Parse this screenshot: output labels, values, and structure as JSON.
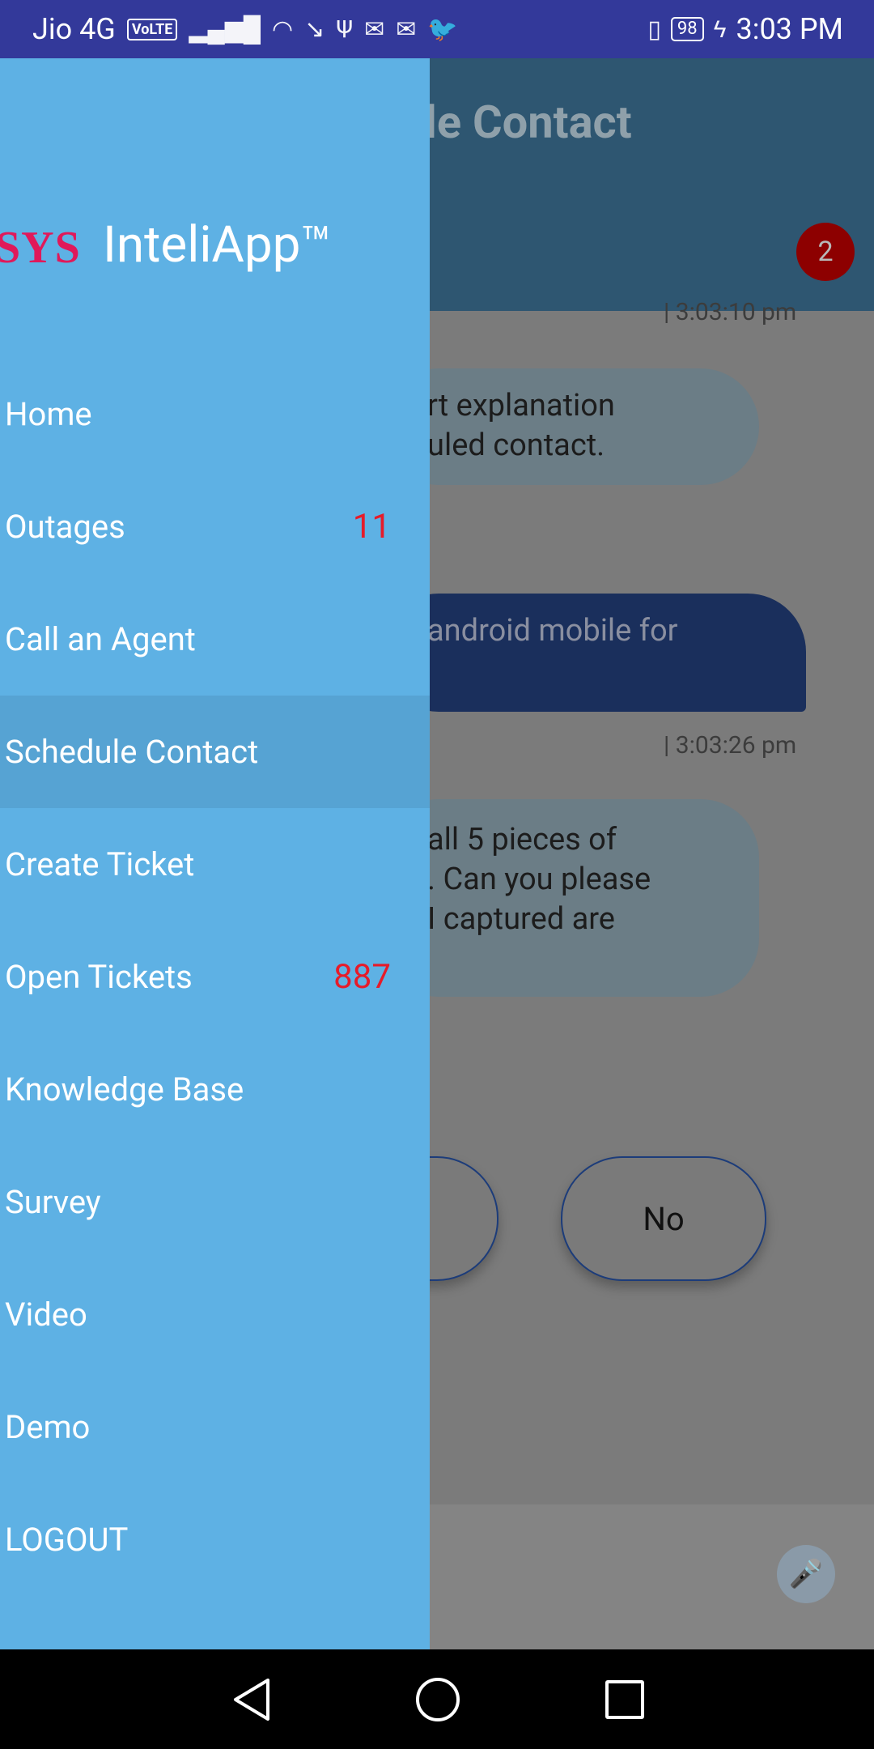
{
  "status_bar": {
    "carrier": "Jio 4G",
    "volte": "VoLTE",
    "battery": "98",
    "time": "3:03 PM"
  },
  "background_app": {
    "title_fragment": "le Contact",
    "badge_count": "2",
    "time_top": "| 3:03:10 pm",
    "bubble1_line1": "rt explanation",
    "bubble1_line2": "uled contact.",
    "bubble2_line1": "android mobile for",
    "time_mid": "| 3:03:26 pm",
    "bubble3_line1": " all 5 pieces of",
    "bubble3_line2": ". Can you please",
    "bubble3_line3": " I captured are",
    "option_no": "No"
  },
  "drawer": {
    "logo_brand": "SYS",
    "logo_app": "InteliApp™",
    "items": [
      {
        "label": "Home",
        "count": ""
      },
      {
        "label": "Outages",
        "count": "11"
      },
      {
        "label": "Call an Agent",
        "count": ""
      },
      {
        "label": "Schedule Contact",
        "count": "",
        "active": true
      },
      {
        "label": "Create Ticket",
        "count": ""
      },
      {
        "label": "Open Tickets",
        "count": "887"
      },
      {
        "label": "Knowledge Base",
        "count": ""
      },
      {
        "label": "Survey",
        "count": ""
      },
      {
        "label": "Video",
        "count": ""
      },
      {
        "label": "Demo",
        "count": ""
      },
      {
        "label": "LOGOUT",
        "count": ""
      }
    ]
  },
  "colors": {
    "status_bar": "#33399a",
    "drawer": "#5eb1e4",
    "drawer_active": "#56a3d3",
    "count": "#e61b2a"
  }
}
